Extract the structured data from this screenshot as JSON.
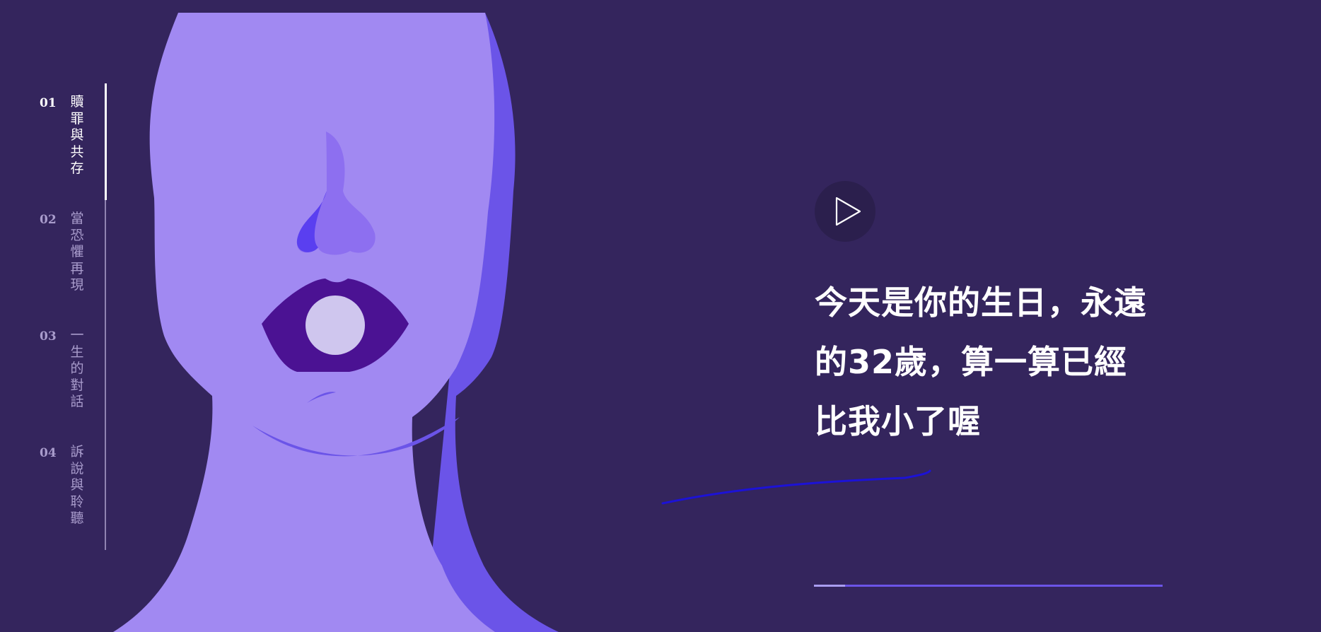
{
  "chapters": [
    {
      "number": "01",
      "title": "贖罪與共存",
      "active": true
    },
    {
      "number": "02",
      "title": "當恐懼再現",
      "active": false
    },
    {
      "number": "03",
      "title": "一生的對話",
      "active": false
    },
    {
      "number": "04",
      "title": "訴說與聆聽",
      "active": false
    }
  ],
  "quote": {
    "text": "今天是你的生日，永遠的32歲，算一算已經比我小了喔"
  },
  "progress": {
    "fraction": 0.09
  },
  "icons": {
    "play": "play-icon"
  },
  "colors": {
    "background": "#34255d",
    "face": "#a189f2",
    "face_shadow": "#6b54e8",
    "mouth": "#4b1293",
    "accent_stroke": "#1c12d6"
  }
}
